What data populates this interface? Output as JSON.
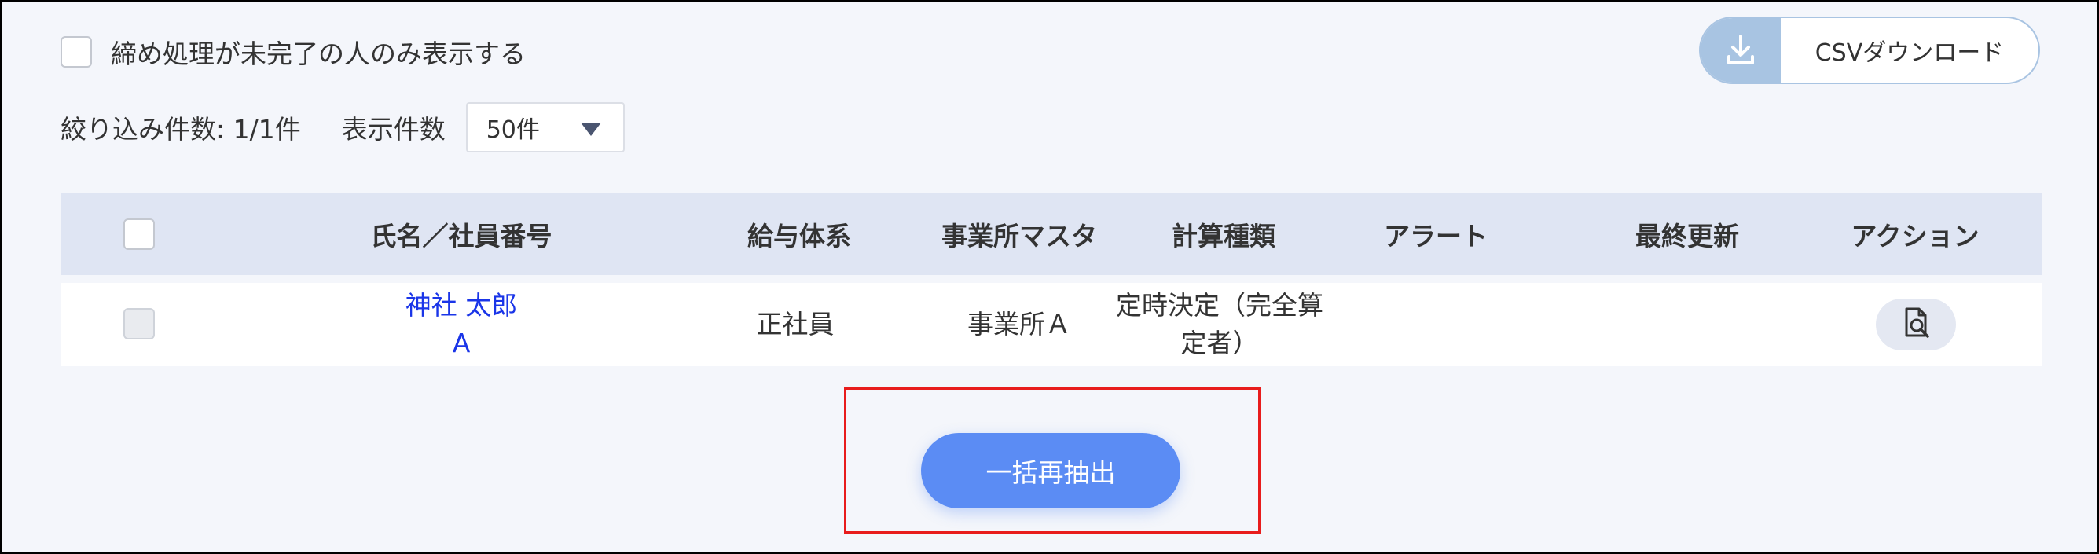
{
  "filter": {
    "only_incomplete_label": "締め処理が未完了の人のみ表示する"
  },
  "toolbar": {
    "csv_label": "CSVダウンロード",
    "count_label": "絞り込み件数: 1/1件",
    "per_page_label": "表示件数",
    "per_page_value": "50件"
  },
  "table": {
    "headers": {
      "name": "氏名／社員番号",
      "salary_system": "給与体系",
      "office_master": "事業所マスタ",
      "calc_type": "計算種類",
      "alert": "アラート",
      "last_updated": "最終更新",
      "action": "アクション"
    },
    "rows": [
      {
        "name_line1": "神社 太郎",
        "name_line2": "A",
        "salary_system": "正社員",
        "office_master": "事業所Ａ",
        "calc_type_line1": "定時決定（完全算",
        "calc_type_line2": "定者）",
        "alert": "",
        "last_updated": ""
      }
    ]
  },
  "bulk": {
    "reextract_label": "一括再抽出"
  },
  "icons": {
    "csv": "download-icon",
    "action": "document-search-icon"
  },
  "colors": {
    "primary": "#5b8cf4",
    "link": "#1a35e8",
    "header_bg": "#dfe5f3",
    "page_bg": "#f4f6fb",
    "highlight": "#e81c1c",
    "csv_icon_bg": "#a8c4e2"
  }
}
